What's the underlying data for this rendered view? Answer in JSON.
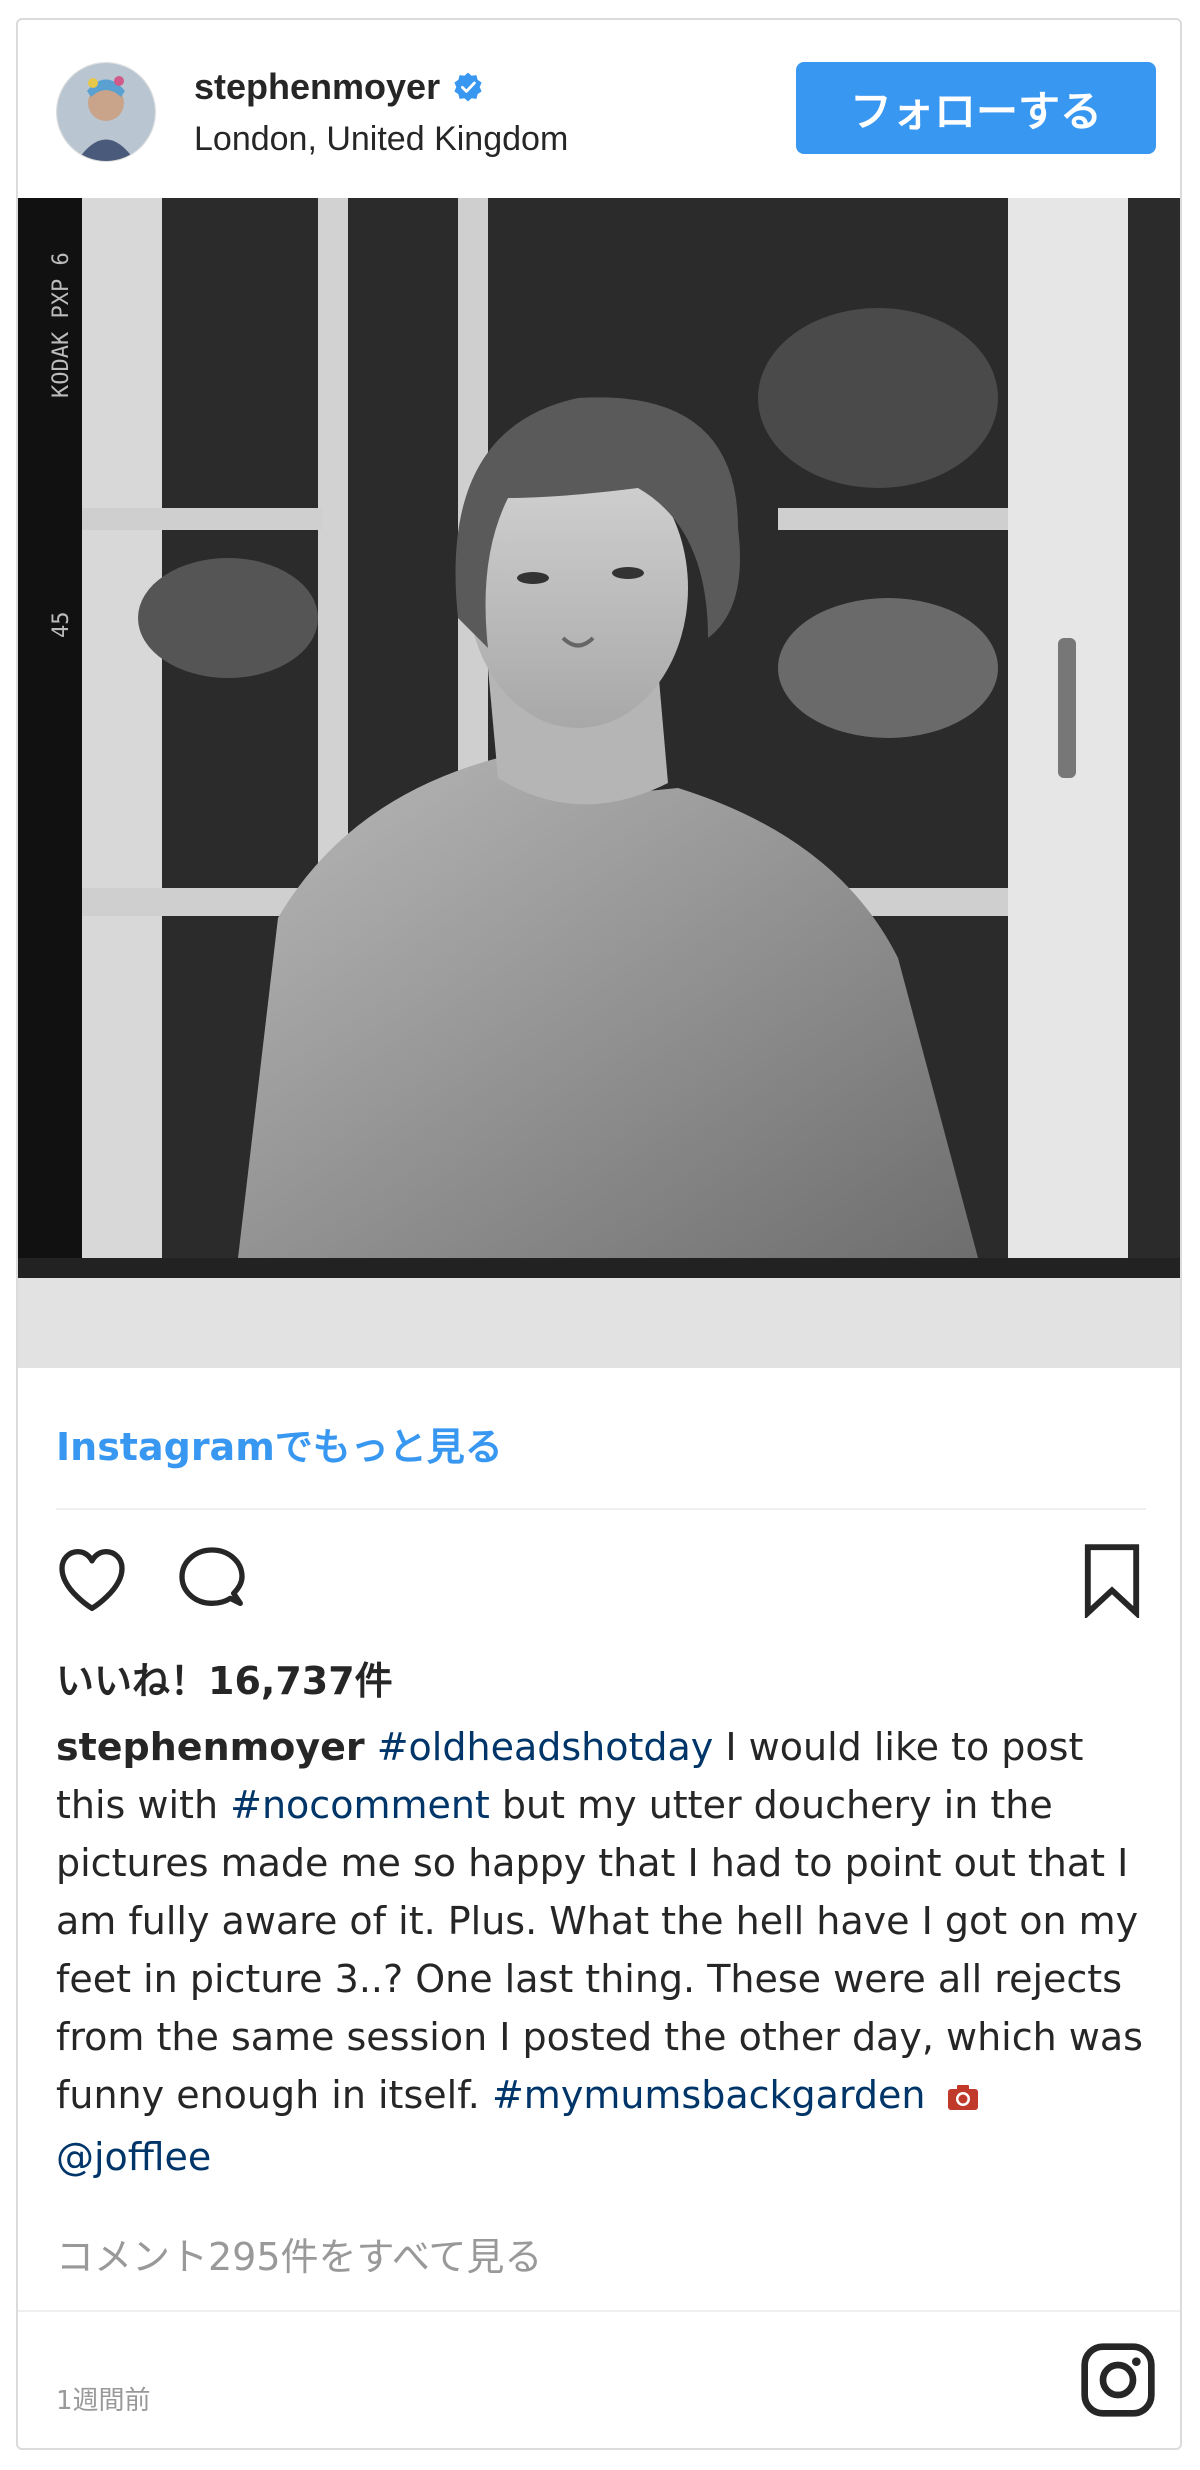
{
  "post": {
    "username": "stephenmoyer",
    "location": "London, United Kingdom",
    "follow_label": "フォローする",
    "view_more_label": "Instagramでもっと見る",
    "likes_label": "いいね！16,737件",
    "caption": {
      "user": "stephenmoyer",
      "hashtag_1": "#oldheadshotday",
      "text_1": " I would like to post this with ",
      "hashtag_2": "#nocomment",
      "text_2": " but my utter douchery in the pictures made me so happy that I had to point out that I am fully aware of it. Plus. What the hell have I got on my feet in picture 3..? One last thing. These were all rejects from the same session I posted the other day, which was funny enough in itself. ",
      "hashtag_3": "#mymumsbackgarden",
      "mention": "@jofflee"
    },
    "view_comments_label": "コメント295件をすべて見る",
    "timestamp": "1週間前",
    "photo_film_text": {
      "brand": "KODAK  PXP 6",
      "frame": "45"
    }
  },
  "icons": {
    "like": "heart-icon",
    "comment": "comment-icon",
    "save": "bookmark-icon",
    "verified": "verified-badge-icon",
    "instagram": "instagram-logo-icon",
    "camera": "camera-emoji-icon"
  },
  "colors": {
    "accent": "#3897f0",
    "hashtag": "#003569",
    "muted": "#999999",
    "text": "#262626"
  }
}
